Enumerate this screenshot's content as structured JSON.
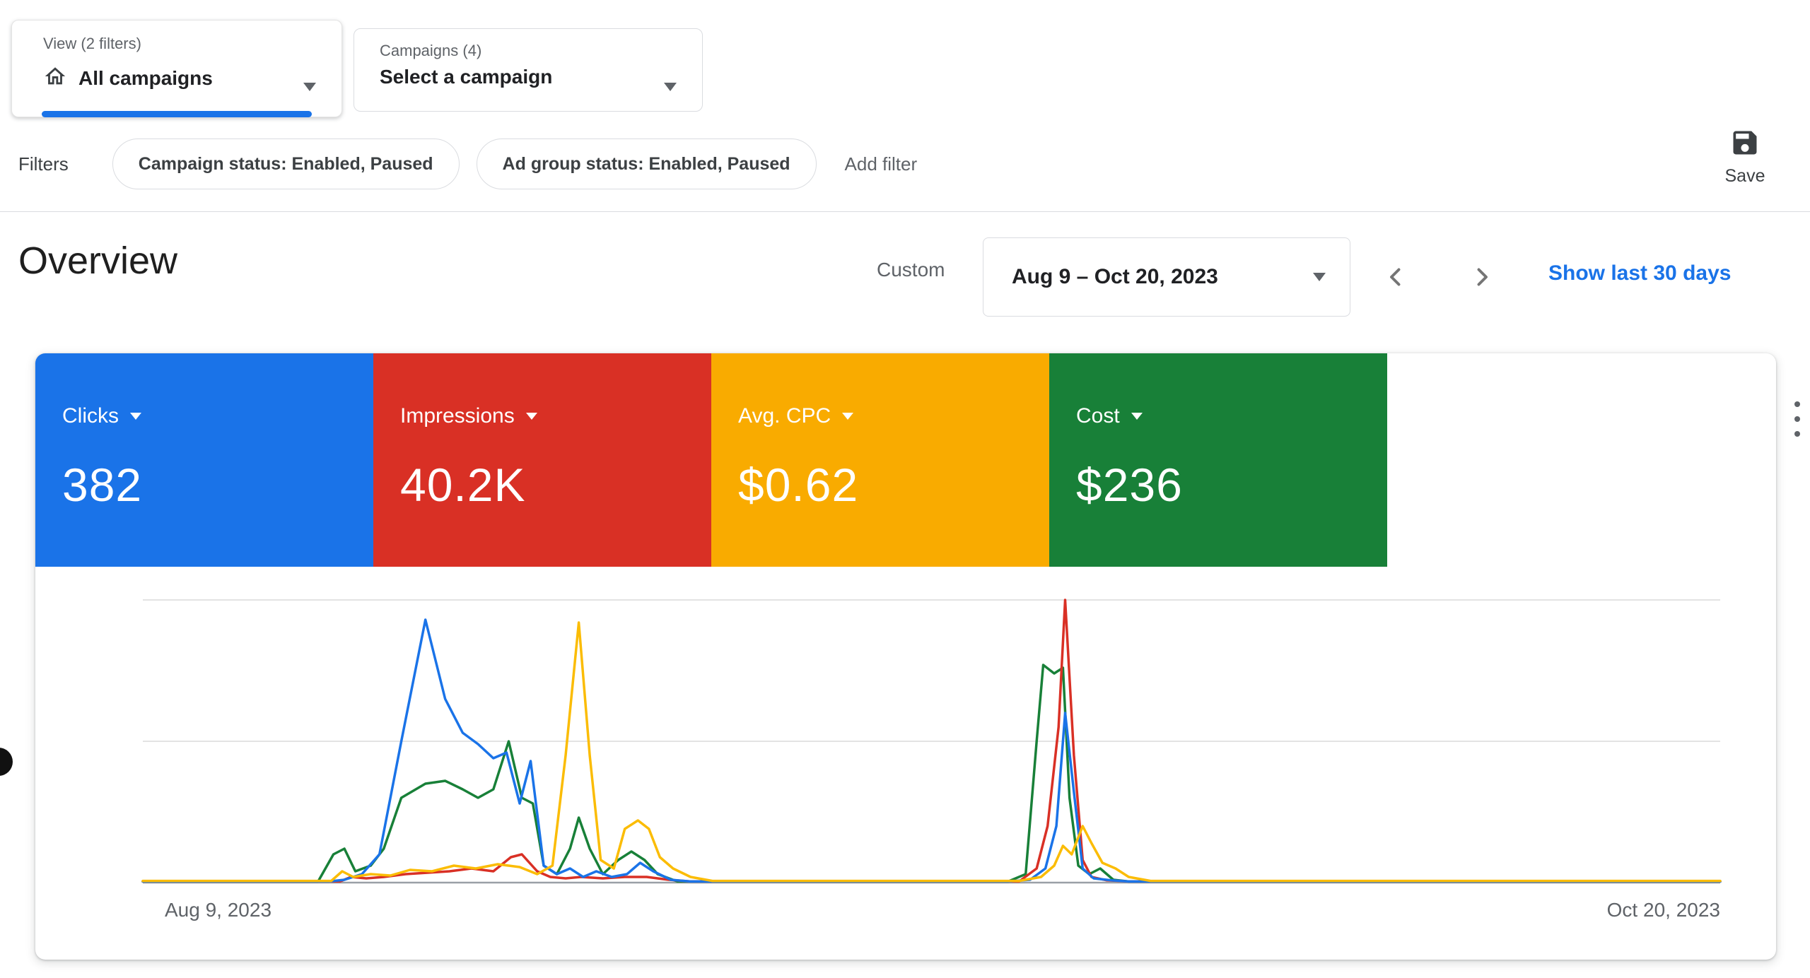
{
  "toolbar": {
    "view_selector": {
      "label": "View (2 filters)",
      "value": "All campaigns"
    },
    "campaign_selector": {
      "label": "Campaigns (4)",
      "value": "Select a campaign"
    }
  },
  "filters_bar": {
    "label": "Filters",
    "chips": [
      "Campaign status: Enabled, Paused",
      "Ad group status: Enabled, Paused"
    ],
    "add_filter_label": "Add filter",
    "save_label": "Save"
  },
  "overview_header": {
    "title": "Overview",
    "date_mode_label": "Custom",
    "date_range": "Aug 9 – Oct 20, 2023",
    "quick_range_link": "Show last 30 days"
  },
  "metric_cards": [
    {
      "label": "Clicks",
      "value": "382",
      "color": "#1a73e8"
    },
    {
      "label": "Impressions",
      "value": "40.2K",
      "color": "#d93025"
    },
    {
      "label": "Avg. CPC",
      "value": "$0.62",
      "color": "#f9ab00"
    },
    {
      "label": "Cost",
      "value": "$236",
      "color": "#188038"
    }
  ],
  "chart_data": {
    "type": "line",
    "title": "Overview performance over time",
    "xlabel_start": "Aug 9, 2023",
    "xlabel_end": "Oct 20, 2023",
    "x_range": [
      "2023-08-09",
      "2023-10-20"
    ],
    "x_days": 72,
    "y_axis_labels_shown": false,
    "y_unit": "relative height: 0 = baseline, 1 = top gridline (y axis unlabeled in UI)",
    "ylim_relative": [
      0,
      1
    ],
    "grid": "3 horizontal lines: top gridline, middle gridline, baseline axis",
    "legend": "none (line colors match metric card colors)",
    "series": [
      {
        "name": "Cost",
        "color": "#188038",
        "points": [
          [
            0,
            0.004
          ],
          [
            8,
            0.004
          ],
          [
            8.7,
            0.1
          ],
          [
            9.2,
            0.12
          ],
          [
            9.7,
            0.04
          ],
          [
            10.4,
            0.06
          ],
          [
            11,
            0.12
          ],
          [
            11.8,
            0.3
          ],
          [
            12.9,
            0.35
          ],
          [
            13.8,
            0.36
          ],
          [
            14.6,
            0.33
          ],
          [
            15.3,
            0.3
          ],
          [
            16,
            0.33
          ],
          [
            16.7,
            0.5
          ],
          [
            17.3,
            0.3
          ],
          [
            17.8,
            0.28
          ],
          [
            18.3,
            0.06
          ],
          [
            18.9,
            0.03
          ],
          [
            19.5,
            0.12
          ],
          [
            19.9,
            0.23
          ],
          [
            20.4,
            0.12
          ],
          [
            21,
            0.03
          ],
          [
            21.7,
            0.08
          ],
          [
            22.3,
            0.11
          ],
          [
            22.9,
            0.08
          ],
          [
            23.5,
            0.03
          ],
          [
            24.4,
            0.004
          ],
          [
            39.5,
            0.004
          ],
          [
            40.3,
            0.03
          ],
          [
            40.8,
            0.5
          ],
          [
            41.1,
            0.77
          ],
          [
            41.6,
            0.74
          ],
          [
            42,
            0.76
          ],
          [
            42.3,
            0.3
          ],
          [
            42.7,
            0.06
          ],
          [
            43.2,
            0.03
          ],
          [
            43.7,
            0.05
          ],
          [
            44.3,
            0.01
          ],
          [
            45,
            0.004
          ],
          [
            72,
            0.004
          ]
        ]
      },
      {
        "name": "Impressions",
        "color": "#d93025",
        "points": [
          [
            0,
            0.004
          ],
          [
            9,
            0.004
          ],
          [
            9.5,
            0.02
          ],
          [
            10.2,
            0.015
          ],
          [
            11,
            0.02
          ],
          [
            12,
            0.03
          ],
          [
            13,
            0.035
          ],
          [
            14,
            0.04
          ],
          [
            15,
            0.05
          ],
          [
            16,
            0.04
          ],
          [
            16.8,
            0.09
          ],
          [
            17.3,
            0.1
          ],
          [
            18,
            0.04
          ],
          [
            18.6,
            0.02
          ],
          [
            19.3,
            0.015
          ],
          [
            20,
            0.02
          ],
          [
            21,
            0.015
          ],
          [
            22,
            0.02
          ],
          [
            23,
            0.02
          ],
          [
            24,
            0.01
          ],
          [
            25,
            0.004
          ],
          [
            40,
            0.004
          ],
          [
            40.8,
            0.05
          ],
          [
            41.3,
            0.2
          ],
          [
            41.8,
            0.55
          ],
          [
            42.1,
            1.0
          ],
          [
            42.5,
            0.45
          ],
          [
            42.9,
            0.08
          ],
          [
            43.3,
            0.02
          ],
          [
            44,
            0.008
          ],
          [
            45,
            0.004
          ],
          [
            72,
            0.004
          ]
        ]
      },
      {
        "name": "Clicks",
        "color": "#1a73e8",
        "points": [
          [
            0,
            0.004
          ],
          [
            8.5,
            0.004
          ],
          [
            9.2,
            0.01
          ],
          [
            10,
            0.03
          ],
          [
            10.8,
            0.1
          ],
          [
            11.8,
            0.5
          ],
          [
            12.9,
            0.93
          ],
          [
            13.8,
            0.65
          ],
          [
            14.6,
            0.53
          ],
          [
            15.3,
            0.49
          ],
          [
            16,
            0.44
          ],
          [
            16.6,
            0.46
          ],
          [
            17.2,
            0.28
          ],
          [
            17.7,
            0.43
          ],
          [
            18.3,
            0.06
          ],
          [
            18.9,
            0.03
          ],
          [
            19.5,
            0.05
          ],
          [
            20.1,
            0.02
          ],
          [
            20.7,
            0.04
          ],
          [
            21.4,
            0.02
          ],
          [
            22.1,
            0.03
          ],
          [
            22.7,
            0.07
          ],
          [
            23.3,
            0.04
          ],
          [
            24.1,
            0.01
          ],
          [
            25,
            0.004
          ],
          [
            39.5,
            0.004
          ],
          [
            40.5,
            0.01
          ],
          [
            41.2,
            0.05
          ],
          [
            41.7,
            0.2
          ],
          [
            42.1,
            0.6
          ],
          [
            42.5,
            0.32
          ],
          [
            42.9,
            0.05
          ],
          [
            43.4,
            0.015
          ],
          [
            44.2,
            0.008
          ],
          [
            45,
            0.004
          ],
          [
            72,
            0.004
          ]
        ]
      },
      {
        "name": "Avg. CPC",
        "color": "#fbbc04",
        "points": [
          [
            0,
            0.006
          ],
          [
            8.6,
            0.006
          ],
          [
            9.1,
            0.04
          ],
          [
            9.6,
            0.02
          ],
          [
            10.4,
            0.03
          ],
          [
            11.3,
            0.025
          ],
          [
            12.2,
            0.045
          ],
          [
            13.2,
            0.04
          ],
          [
            14.2,
            0.06
          ],
          [
            15.2,
            0.05
          ],
          [
            16.2,
            0.065
          ],
          [
            17.2,
            0.055
          ],
          [
            18,
            0.03
          ],
          [
            18.7,
            0.06
          ],
          [
            19.3,
            0.45
          ],
          [
            19.9,
            0.92
          ],
          [
            20.4,
            0.45
          ],
          [
            20.9,
            0.08
          ],
          [
            21.5,
            0.05
          ],
          [
            22,
            0.19
          ],
          [
            22.6,
            0.22
          ],
          [
            23.1,
            0.19
          ],
          [
            23.6,
            0.09
          ],
          [
            24.2,
            0.05
          ],
          [
            25,
            0.02
          ],
          [
            26,
            0.006
          ],
          [
            40,
            0.006
          ],
          [
            41,
            0.02
          ],
          [
            41.6,
            0.06
          ],
          [
            42,
            0.13
          ],
          [
            42.4,
            0.1
          ],
          [
            42.9,
            0.2
          ],
          [
            43.3,
            0.14
          ],
          [
            43.8,
            0.07
          ],
          [
            44.4,
            0.05
          ],
          [
            45,
            0.02
          ],
          [
            46,
            0.006
          ],
          [
            72,
            0.006
          ]
        ]
      }
    ]
  }
}
